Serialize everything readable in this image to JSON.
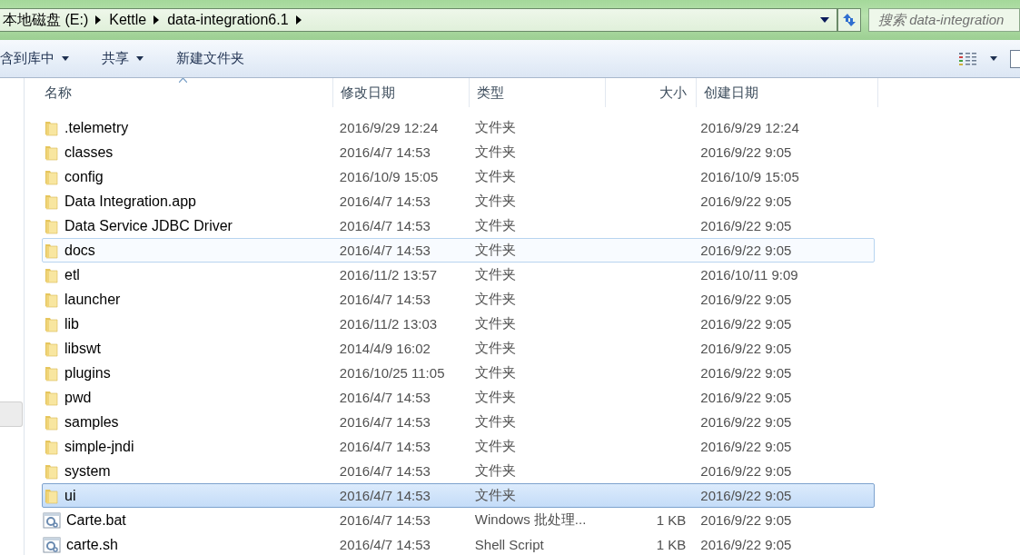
{
  "address_bar": {
    "crumbs": [
      "本地磁盘 (E:)",
      "Kettle",
      "data-integration6.1"
    ]
  },
  "search": {
    "placeholder": "搜索 data-integration"
  },
  "toolbar": {
    "buttons": [
      {
        "label": "含到库中",
        "menu": true
      },
      {
        "label": "共享",
        "menu": true
      },
      {
        "label": "新建文件夹",
        "menu": false
      }
    ]
  },
  "table": {
    "columns": [
      "名称",
      "修改日期",
      "类型",
      "大小",
      "创建日期"
    ],
    "rows": [
      {
        "kind": "folder",
        "name": ".telemetry",
        "modified": "2016/9/29 12:24",
        "type": "文件夹",
        "created": "2016/9/29 12:24",
        "selected": false,
        "hovered": false
      },
      {
        "kind": "folder",
        "name": "classes",
        "modified": "2016/4/7 14:53",
        "type": "文件夹",
        "created": "2016/9/22 9:05",
        "selected": false,
        "hovered": false
      },
      {
        "kind": "folder",
        "name": "config",
        "modified": "2016/10/9 15:05",
        "type": "文件夹",
        "created": "2016/10/9 15:05",
        "selected": false,
        "hovered": false
      },
      {
        "kind": "folder",
        "name": "Data Integration.app",
        "modified": "2016/4/7 14:53",
        "type": "文件夹",
        "created": "2016/9/22 9:05",
        "selected": false,
        "hovered": false
      },
      {
        "kind": "folder",
        "name": "Data Service JDBC Driver",
        "modified": "2016/4/7 14:53",
        "type": "文件夹",
        "created": "2016/9/22 9:05",
        "selected": false,
        "hovered": false
      },
      {
        "kind": "folder",
        "name": "docs",
        "modified": "2016/4/7 14:53",
        "type": "文件夹",
        "created": "2016/9/22 9:05",
        "selected": false,
        "hovered": true
      },
      {
        "kind": "folder",
        "name": "etl",
        "modified": "2016/11/2 13:57",
        "type": "文件夹",
        "created": "2016/10/11 9:09",
        "selected": false,
        "hovered": false
      },
      {
        "kind": "folder",
        "name": "launcher",
        "modified": "2016/4/7 14:53",
        "type": "文件夹",
        "created": "2016/9/22 9:05",
        "selected": false,
        "hovered": false
      },
      {
        "kind": "folder",
        "name": "lib",
        "modified": "2016/11/2 13:03",
        "type": "文件夹",
        "created": "2016/9/22 9:05",
        "selected": false,
        "hovered": false
      },
      {
        "kind": "folder",
        "name": "libswt",
        "modified": "2014/4/9 16:02",
        "type": "文件夹",
        "created": "2016/9/22 9:05",
        "selected": false,
        "hovered": false
      },
      {
        "kind": "folder",
        "name": "plugins",
        "modified": "2016/10/25 11:05",
        "type": "文件夹",
        "created": "2016/9/22 9:05",
        "selected": false,
        "hovered": false
      },
      {
        "kind": "folder",
        "name": "pwd",
        "modified": "2016/4/7 14:53",
        "type": "文件夹",
        "created": "2016/9/22 9:05",
        "selected": false,
        "hovered": false
      },
      {
        "kind": "folder",
        "name": "samples",
        "modified": "2016/4/7 14:53",
        "type": "文件夹",
        "created": "2016/9/22 9:05",
        "selected": false,
        "hovered": false
      },
      {
        "kind": "folder",
        "name": "simple-jndi",
        "modified": "2016/4/7 14:53",
        "type": "文件夹",
        "created": "2016/9/22 9:05",
        "selected": false,
        "hovered": false
      },
      {
        "kind": "folder",
        "name": "system",
        "modified": "2016/4/7 14:53",
        "type": "文件夹",
        "created": "2016/9/22 9:05",
        "selected": false,
        "hovered": false
      },
      {
        "kind": "folder",
        "name": "ui",
        "modified": "2016/4/7 14:53",
        "type": "文件夹",
        "created": "2016/9/22 9:05",
        "selected": true,
        "hovered": false
      },
      {
        "kind": "script",
        "name": "Carte.bat",
        "modified": "2016/4/7 14:53",
        "type": "Windows 批处理...",
        "size": "1 KB",
        "created": "2016/9/22 9:05",
        "selected": false,
        "hovered": false
      },
      {
        "kind": "script",
        "name": "carte.sh",
        "modified": "2016/4/7 14:53",
        "type": "Shell Script",
        "size": "1 KB",
        "created": "2016/9/22 9:05",
        "selected": false,
        "hovered": false
      }
    ]
  }
}
